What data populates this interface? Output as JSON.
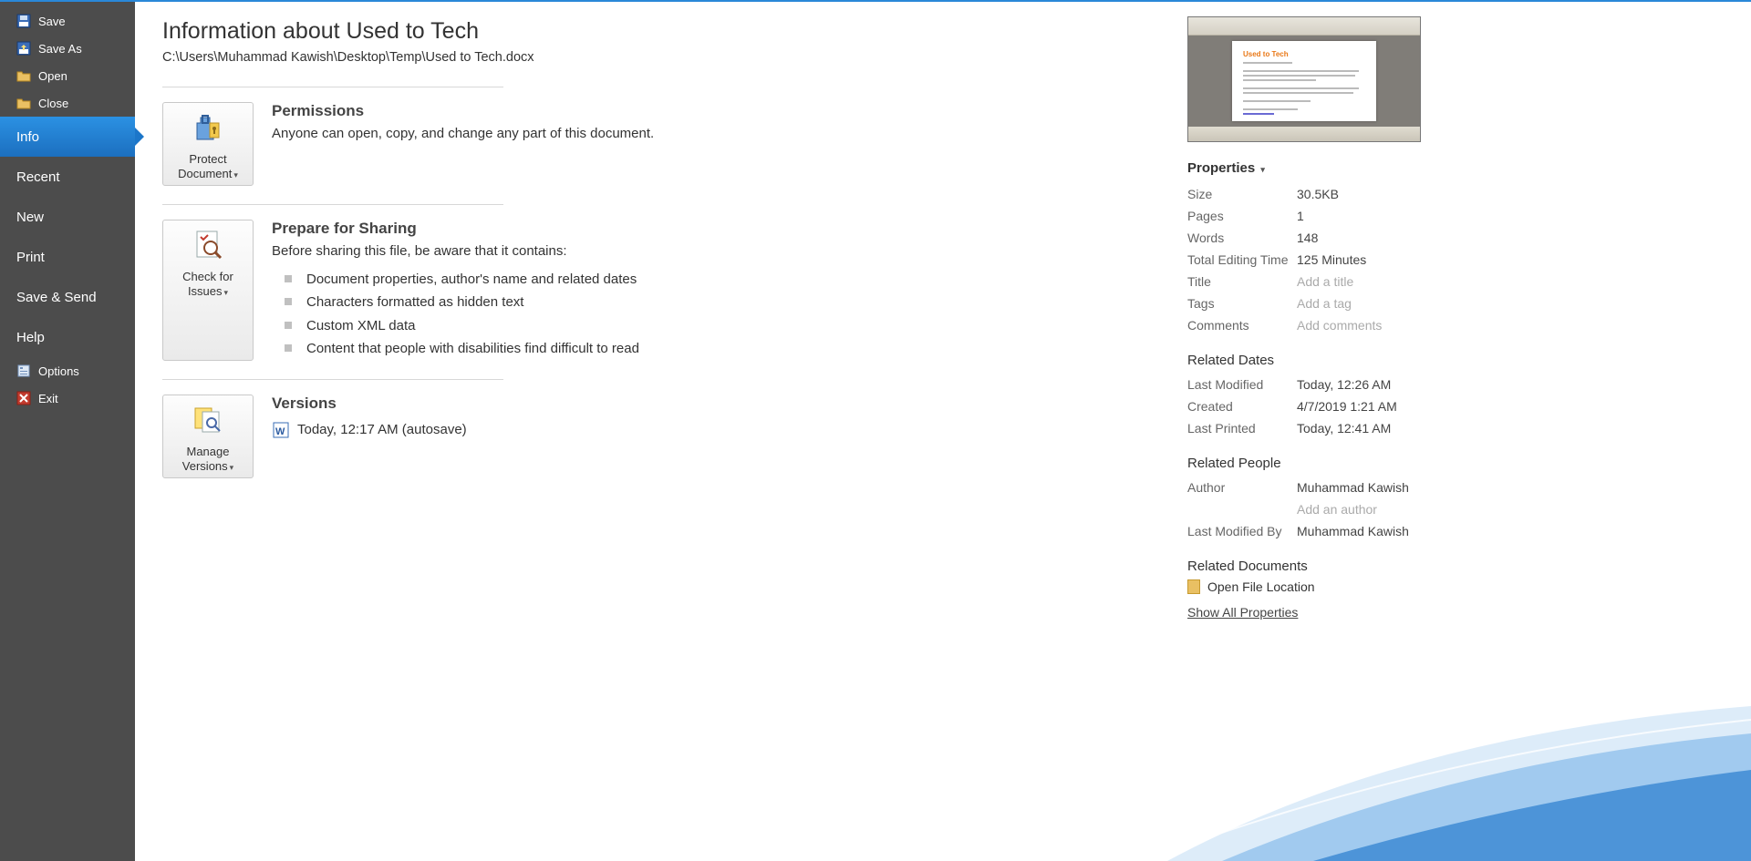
{
  "sidebar": {
    "save": "Save",
    "saveas": "Save As",
    "open": "Open",
    "close": "Close",
    "info": "Info",
    "recent": "Recent",
    "new": "New",
    "print": "Print",
    "savesend": "Save & Send",
    "help": "Help",
    "options": "Options",
    "exit": "Exit"
  },
  "header": {
    "title": "Information about Used to Tech",
    "path": "C:\\Users\\Muhammad Kawish\\Desktop\\Temp\\Used to Tech.docx"
  },
  "permissions": {
    "button_l1": "Protect",
    "button_l2": "Document",
    "heading": "Permissions",
    "text": "Anyone can open, copy, and change any part of this document."
  },
  "prepare": {
    "button_l1": "Check for",
    "button_l2": "Issues",
    "heading": "Prepare for Sharing",
    "intro": "Before sharing this file, be aware that it contains:",
    "items": [
      "Document properties, author's name and related dates",
      "Characters formatted as hidden text",
      "Custom XML data",
      "Content that people with disabilities find difficult to read"
    ]
  },
  "versions": {
    "button_l1": "Manage",
    "button_l2": "Versions",
    "heading": "Versions",
    "entry": "Today, 12:17 AM (autosave)"
  },
  "thumb": {
    "title": "Used to Tech"
  },
  "props": {
    "header": "Properties",
    "rows": {
      "size_k": "Size",
      "size_v": "30.5KB",
      "pages_k": "Pages",
      "pages_v": "1",
      "words_k": "Words",
      "words_v": "148",
      "edit_k": "Total Editing Time",
      "edit_v": "125 Minutes",
      "title_k": "Title",
      "title_ph": "Add a title",
      "tags_k": "Tags",
      "tags_ph": "Add a tag",
      "comments_k": "Comments",
      "comments_ph": "Add comments"
    }
  },
  "dates": {
    "header": "Related Dates",
    "lm_k": "Last Modified",
    "lm_v": "Today, 12:26 AM",
    "cr_k": "Created",
    "cr_v": "4/7/2019 1:21 AM",
    "lp_k": "Last Printed",
    "lp_v": "Today, 12:41 AM"
  },
  "people": {
    "header": "Related People",
    "author_k": "Author",
    "author_v": "Muhammad Kawish",
    "author_ph": "Add an author",
    "lmb_k": "Last Modified By",
    "lmb_v": "Muhammad Kawish"
  },
  "docs": {
    "header": "Related Documents",
    "open_loc": "Open File Location",
    "show_all": "Show All Properties"
  }
}
